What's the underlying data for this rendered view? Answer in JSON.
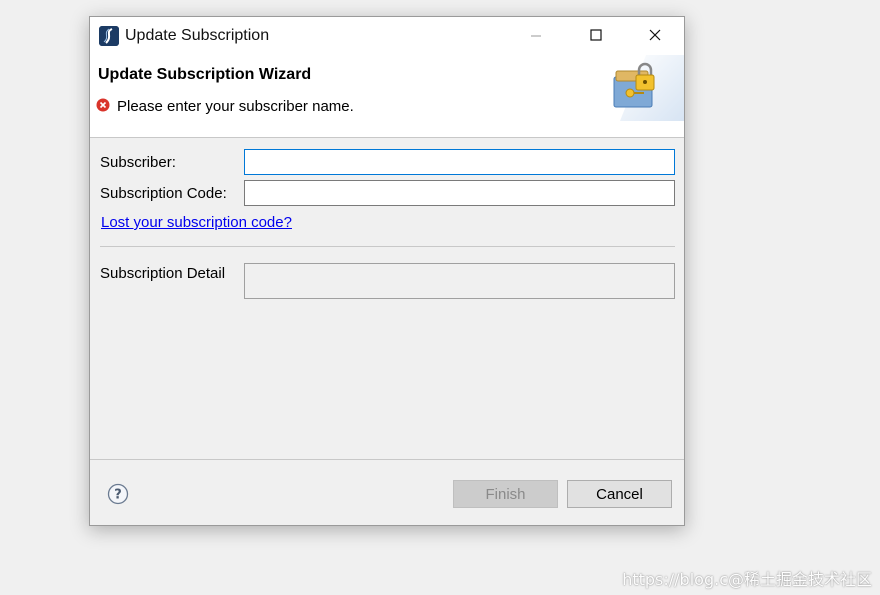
{
  "window": {
    "title": "Update Subscription",
    "app_icon": "eclipse-app-icon",
    "controls": {
      "minimize": "minimize-icon",
      "maximize": "maximize-icon",
      "close": "close-icon"
    }
  },
  "header": {
    "wizard_title": "Update Subscription Wizard",
    "error_message": "Please enter your subscriber name.",
    "error_icon": "error-icon",
    "banner_icon": "lock-key-icon"
  },
  "form": {
    "subscriber_label": "Subscriber:",
    "subscriber_value": "",
    "code_label": "Subscription Code:",
    "code_value": "",
    "lost_code_link": "Lost your subscription code?",
    "detail_label": "Subscription Detail",
    "detail_value": ""
  },
  "footer": {
    "help_icon": "help-icon",
    "finish_label": "Finish",
    "cancel_label": "Cancel"
  },
  "watermark": "https://blog.c@稀土掘金技术社区",
  "colors": {
    "link": "#0000ee",
    "focus_border": "#0078d7",
    "error": "#d9342b"
  }
}
